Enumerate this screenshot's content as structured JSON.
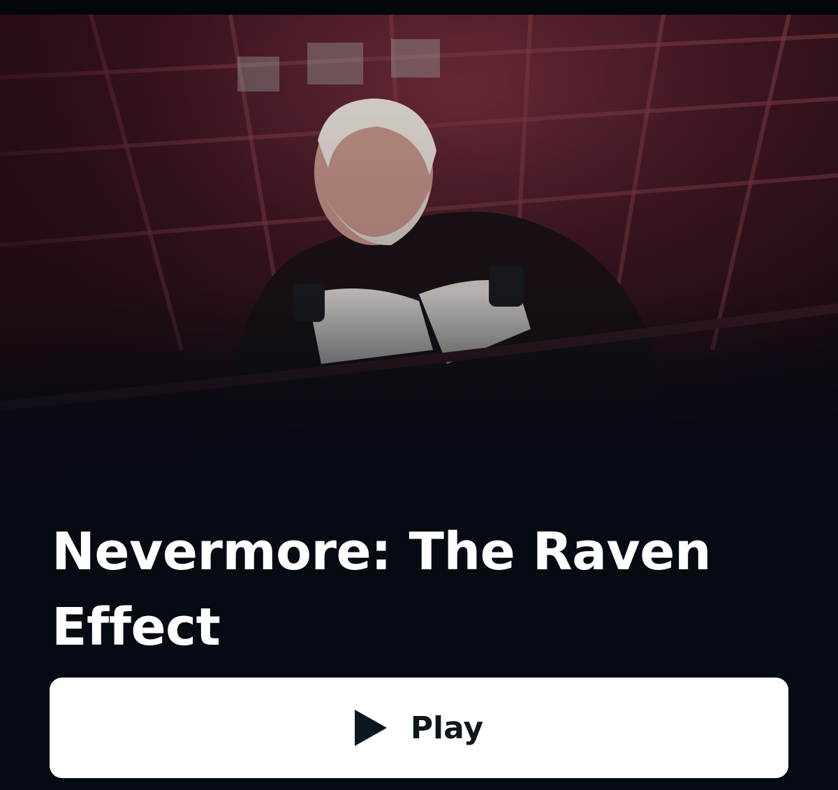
{
  "detail": {
    "title": "Nevermore: The Raven Effect",
    "hero_image": "wrestler-portrait-ring-ropes"
  },
  "actions": {
    "play_label": "Play",
    "play_icon": "play-icon"
  },
  "colors": {
    "background": "#050a13",
    "button_background": "#ffffff",
    "button_text": "#0f171e",
    "title_text": "#ffffff",
    "hero_tint": "#7a2432"
  }
}
